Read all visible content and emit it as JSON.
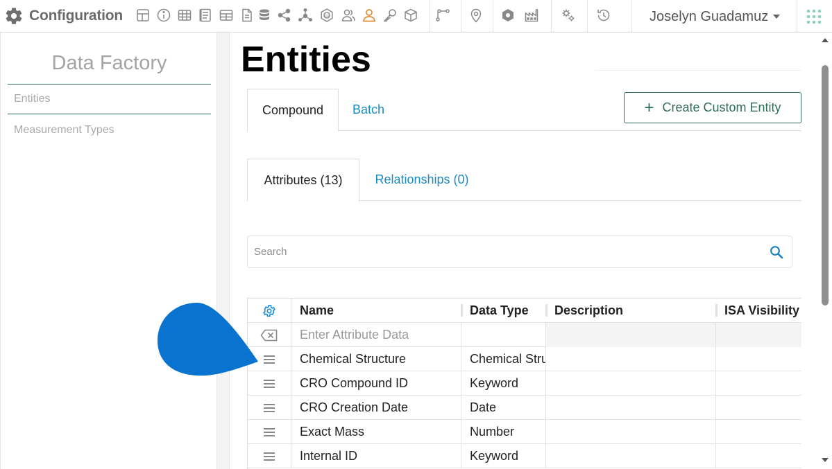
{
  "app": {
    "title": "Configuration",
    "user_name": "Joselyn Guadamuz"
  },
  "toolbar_icons": [
    "layout-icon",
    "info-icon",
    "table-icon",
    "notebook-icon",
    "grid-table-icon",
    "document-icon",
    "database-icon",
    "share-icon",
    "network-icon",
    "flask-icon",
    "users-icon",
    "user-icon",
    "key-icon",
    "cube-icon",
    "route-icon",
    "location-pin-icon",
    "hexagon-icon",
    "factory-icon",
    "settings-gears-icon",
    "history-icon"
  ],
  "sidebar": {
    "title": "Data Factory",
    "items": [
      {
        "label": "Entities",
        "active": true
      },
      {
        "label": "Measurement Types",
        "active": false
      }
    ]
  },
  "main": {
    "title": "Entities",
    "entity_tabs": [
      {
        "label": "Compound",
        "active": true
      },
      {
        "label": "Batch",
        "active": false
      }
    ],
    "create_button_label": "Create Custom Entity",
    "sub_tabs": [
      {
        "label": "Attributes (13)",
        "active": true
      },
      {
        "label": "Relationships (0)",
        "active": false
      }
    ],
    "search": {
      "placeholder": "Search",
      "value": ""
    }
  },
  "grid": {
    "columns": [
      "Name",
      "Data Type",
      "Description",
      "ISA Visibility"
    ],
    "filter_placeholder": "Enter Attribute Data",
    "rows": [
      {
        "name": "Chemical Structure",
        "type": "Chemical Structure",
        "description": "",
        "visibility": ""
      },
      {
        "name": "CRO Compound ID",
        "type": "Keyword",
        "description": "",
        "visibility": ""
      },
      {
        "name": "CRO Creation Date",
        "type": "Date",
        "description": "",
        "visibility": ""
      },
      {
        "name": "Exact Mass",
        "type": "Number",
        "description": "",
        "visibility": ""
      },
      {
        "name": "Internal ID",
        "type": "Keyword",
        "description": "",
        "visibility": ""
      }
    ]
  },
  "colors": {
    "accent_green": "#2f6e55",
    "link_blue": "#1a8cc4",
    "icon_blue": "#1e7fbf",
    "blob_blue": "#0a73cf",
    "user_icon_orange": "#e08a2e"
  }
}
